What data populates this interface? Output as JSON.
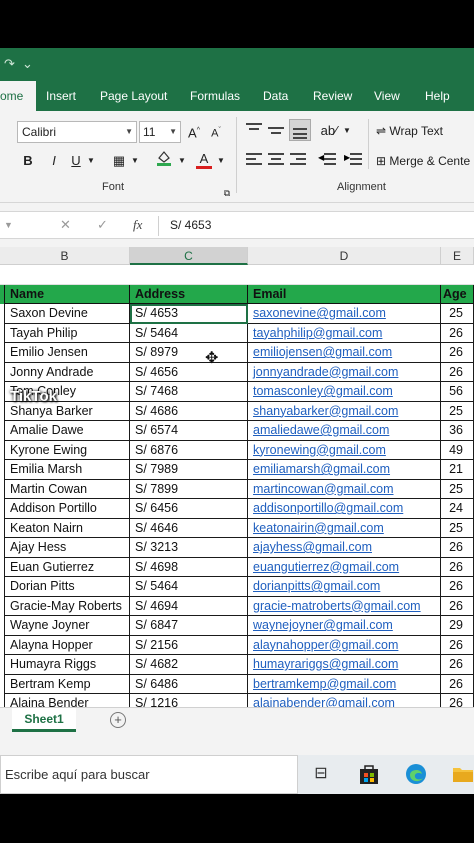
{
  "ribbon": {
    "tabs": [
      "ome",
      "Insert",
      "Page Layout",
      "Formulas",
      "Data",
      "Review",
      "View",
      "Help"
    ],
    "font_name": "Calibri",
    "font_size": "11",
    "font_group_label": "Font",
    "alignment_group_label": "Alignment",
    "wrap_text": "Wrap Text",
    "merge_center": "Merge & Cente",
    "bold": "B",
    "italic": "I",
    "underline": "U",
    "grow_font": "A",
    "shrink_font": "A",
    "font_color": "A"
  },
  "formula_bar": {
    "fx": "fx",
    "value": "S/ 4653"
  },
  "columns": {
    "b": "B",
    "c": "C",
    "d": "D",
    "e": "E"
  },
  "table": {
    "headers": [
      "Name",
      "Address",
      "Email",
      "Age"
    ],
    "rows": [
      [
        "Saxon Devine",
        "S/ 4653",
        "saxonevine@gmail.com",
        "25"
      ],
      [
        "Tayah Philip",
        "S/ 5464",
        "tayahphilip@gmail.com",
        "26"
      ],
      [
        "Emilio Jensen",
        "S/ 8979",
        "emiliojensen@gmail.com",
        "26"
      ],
      [
        "Jonny Andrade",
        "S/ 4656",
        "jonnyandrade@gmail.com",
        "26"
      ],
      [
        "Tom Conley",
        "S/ 7468",
        "tomasconley@gmail.com",
        "56"
      ],
      [
        "Shanya Barker",
        "S/ 4686",
        "shanyabarker@gmail.com",
        "25"
      ],
      [
        "Amalie Dawe",
        "S/ 6574",
        "amaliedawe@gmail.com",
        "36"
      ],
      [
        "Kyrone Ewing",
        "S/ 6876",
        "kyronewing@gmail.com",
        "49"
      ],
      [
        "Emilia Marsh",
        "S/ 7989",
        "emiliamarsh@gmail.com",
        "21"
      ],
      [
        "Martin Cowan",
        "S/ 7899",
        "martincowan@gmail.com",
        "25"
      ],
      [
        "Addison Portillo",
        "S/ 6456",
        "addisonportillo@gmail.com",
        "24"
      ],
      [
        "Keaton Nairn",
        "S/ 4646",
        "keatonairin@gmail.com",
        "25"
      ],
      [
        "Ajay Hess",
        "S/ 3213",
        "ajayhess@gmail.com",
        "26"
      ],
      [
        "Euan Gutierrez",
        "S/ 4698",
        "euangutierrez@gmail.com",
        "26"
      ],
      [
        "Dorian Pitts",
        "S/ 5464",
        "dorianpitts@gmail.com",
        "26"
      ],
      [
        "Gracie-May Roberts",
        "S/ 4694",
        "gracie-matroberts@gmail.com",
        "26"
      ],
      [
        "Wayne Joyner",
        "S/ 6847",
        "waynejoyner@gmail.com",
        "29"
      ],
      [
        "Alayna Hopper",
        "S/ 2156",
        "alaynahopper@gmail.com",
        "26"
      ],
      [
        "Humayra Riggs",
        "S/ 4682",
        "humayrariggs@gmail.com",
        "26"
      ],
      [
        "Bertram Kemp",
        "S/ 6486",
        "bertramkemp@gmail.com",
        "26"
      ],
      [
        "Alaina Bender",
        "S/ 1216",
        "alainabender@gmail.com",
        "26"
      ]
    ]
  },
  "sheet_tab": "Sheet1",
  "add_sheet": "+",
  "taskbar": {
    "search_placeholder": "Escribe aquí para buscar"
  },
  "watermark": {
    "brand": "TikTok"
  },
  "colors": {
    "excel_green": "#1e7145",
    "header_fill": "#23a84b",
    "link_blue": "#1f5fbf"
  }
}
